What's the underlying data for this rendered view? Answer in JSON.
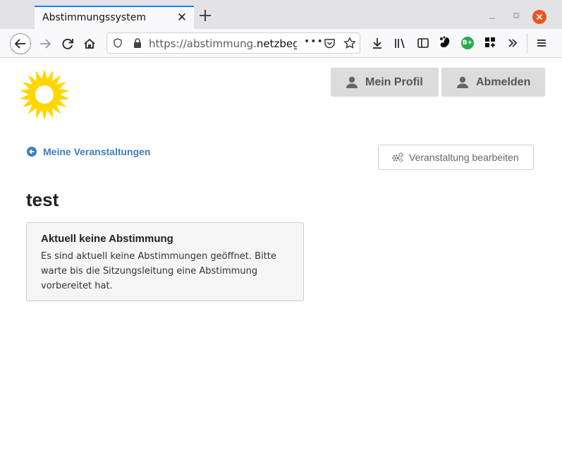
{
  "browser": {
    "tab_title": "Abstimmungssystem",
    "url_prefix": "https://abstimmung.",
    "url_domain": "netzbegrü",
    "url_more": "•••"
  },
  "header": {
    "profile_button": "Mein Profil",
    "logout_button": "Abmelden"
  },
  "main": {
    "back_link": "Meine Veranstaltungen",
    "edit_button": "Veranstaltung bearbeiten",
    "title": "test",
    "notice": {
      "title": "Aktuell keine Abstimmung",
      "text": "Es sind aktuell keine Abstimmungen geöffnet. Bitte warte bis die Sitzungsleitung eine Abstimmung vorbereitet hat."
    }
  },
  "colors": {
    "accent": "#3d7ec0",
    "sunflower": "#ffd600",
    "button_gray": "#dcdcdc"
  }
}
